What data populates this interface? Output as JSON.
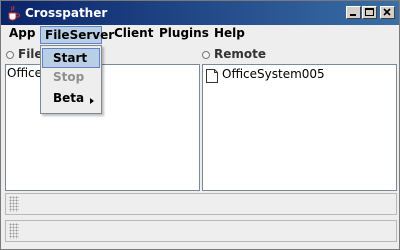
{
  "window": {
    "title": "Crosspather",
    "icon": "java-cup-icon",
    "controls": [
      "minimize-icon",
      "maximize-icon",
      "close-icon"
    ]
  },
  "menubar": {
    "items": [
      {
        "label": "App"
      },
      {
        "label": "FileServer",
        "active": true
      },
      {
        "label": "Client"
      },
      {
        "label": "Plugins"
      },
      {
        "label": "Help"
      }
    ]
  },
  "dropdown": {
    "items": [
      {
        "label": "Start",
        "state": "selected"
      },
      {
        "label": "Stop",
        "state": "disabled"
      },
      {
        "label": "Beta",
        "state": "normal",
        "submenu": true
      }
    ]
  },
  "panels": {
    "left": {
      "header": "FileS",
      "rows": [
        {
          "label": "OfficeS"
        }
      ]
    },
    "right": {
      "header": "Remote",
      "rows": [
        {
          "label": "OfficeSystem005",
          "icon": "file-icon"
        }
      ]
    }
  },
  "colors": {
    "titlebar_start": "#0a246a",
    "titlebar_end": "#3a6ea5",
    "menu_highlight": "#b8cfe5",
    "menu_highlight_border": "#6382bf",
    "disabled_text": "#8f8f8f"
  }
}
